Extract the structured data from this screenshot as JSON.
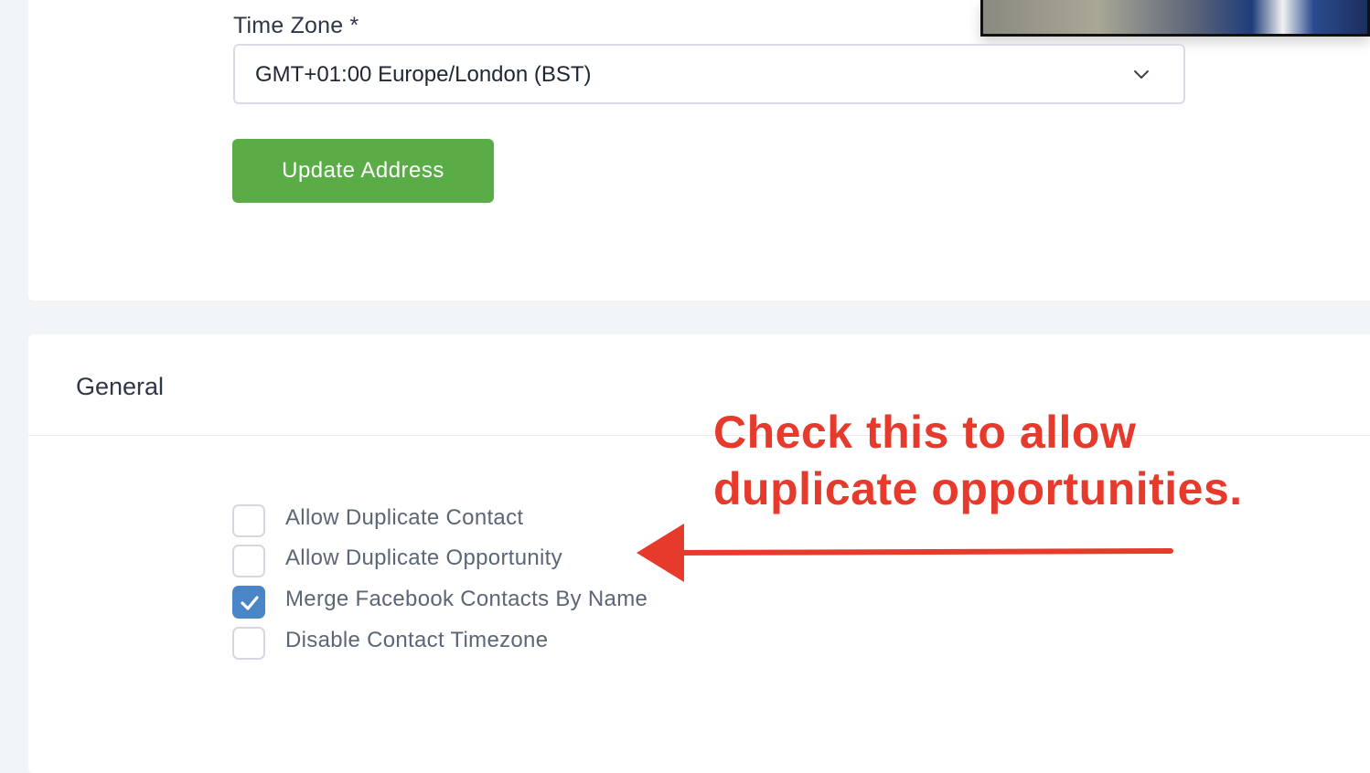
{
  "address_section": {
    "timezone_label": "Time Zone *",
    "timezone_value": "GMT+01:00 Europe/London (BST)",
    "timezone_chevron_icon": "chevron-down-icon",
    "update_button_label": "Update Address"
  },
  "general_section": {
    "title": "General",
    "options": [
      {
        "label": "Allow Duplicate Contact",
        "checked": false
      },
      {
        "label": "Allow Duplicate Opportunity",
        "checked": false
      },
      {
        "label": "Merge Facebook Contacts By Name",
        "checked": true
      },
      {
        "label": "Disable Contact Timezone",
        "checked": false
      }
    ]
  },
  "annotation": {
    "text": "Check this to allow\nduplicate opportunities.",
    "color": "#e53a2c"
  },
  "colors": {
    "primary_button": "#5aad46",
    "checkbox_checked": "#4a86c6",
    "page_background": "#f2f5f8"
  }
}
